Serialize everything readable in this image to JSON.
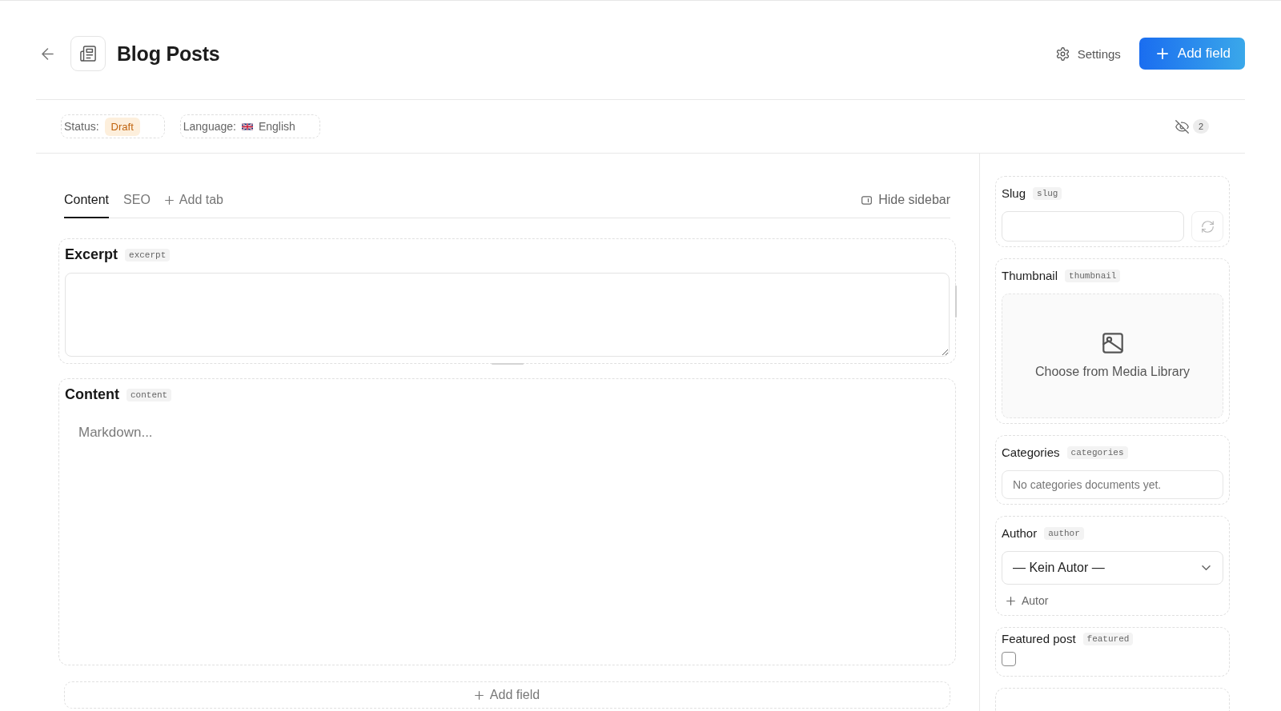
{
  "header": {
    "title": "Blog Posts",
    "settings": "Settings",
    "add_field": "Add field"
  },
  "meta_bar": {
    "status": {
      "label": "Status:",
      "value": "Draft"
    },
    "language": {
      "label": "Language:",
      "value": "English"
    },
    "hidden_count": "2"
  },
  "editor": {
    "tabs": [
      {
        "label": "Content",
        "selected": true
      },
      {
        "label": "SEO",
        "selected": false
      }
    ],
    "add_tab": "Add tab",
    "hide_sidebar": "Hide sidebar",
    "fields": [
      {
        "kind": "textarea",
        "label": "Excerpt",
        "key": "excerpt"
      },
      {
        "kind": "markdown",
        "label": "Content",
        "key": "content",
        "placeholder": "Markdown..."
      }
    ],
    "add_field": "Add field"
  },
  "sidebar": {
    "fields": [
      {
        "kind": "slug",
        "label": "Slug",
        "key": "slug"
      },
      {
        "kind": "media",
        "label": "Thumbnail",
        "key": "thumbnail",
        "action": "Choose from Media Library"
      },
      {
        "kind": "relation",
        "label": "Categories",
        "key": "categories",
        "empty_text": "No categories documents yet."
      },
      {
        "kind": "select",
        "label": "Author",
        "key": "author",
        "value": "— Kein Autor —",
        "add_label": "Autor"
      },
      {
        "kind": "checkbox",
        "label": "Featured post",
        "key": "featured",
        "checked": false
      },
      {
        "kind": "partial"
      }
    ]
  }
}
